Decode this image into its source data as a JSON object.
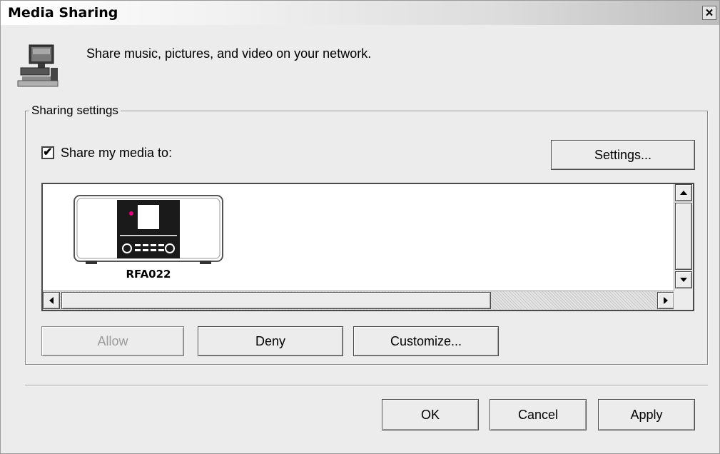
{
  "window": {
    "title": "Media Sharing",
    "close_symbol": "×",
    "icon": "network-computer-icon"
  },
  "header": {
    "description": "Share music, pictures, and video on your network."
  },
  "sharing_settings": {
    "legend": "Sharing settings",
    "share_checkbox": {
      "label": "Share my media to:",
      "checked": true,
      "mark": "✔"
    },
    "settings_button": "Settings...",
    "devices": [
      {
        "name": "RFA022",
        "icon": "internet-radio-icon",
        "led_color": "#e0007a"
      }
    ],
    "allow_button": "Allow",
    "deny_button": "Deny",
    "customize_button": "Customize..."
  },
  "footer": {
    "ok_button": "OK",
    "cancel_button": "Cancel",
    "apply_button": "Apply"
  }
}
